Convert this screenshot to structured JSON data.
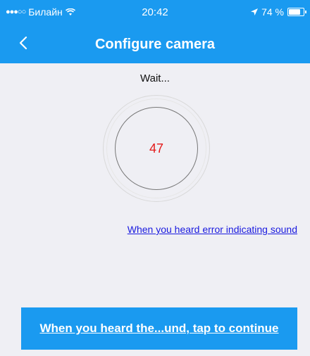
{
  "status_bar": {
    "carrier": "Билайн",
    "time": "20:42",
    "battery_percent": "74 %",
    "battery_level": 0.74,
    "icons": [
      "signal-dots-icon",
      "wifi-icon",
      "location-arrow-icon",
      "battery-icon"
    ]
  },
  "nav": {
    "title": "Configure camera",
    "back_icon": "chevron-left-icon"
  },
  "main": {
    "wait_text": "Wait...",
    "countdown": "47",
    "error_link": "When you heard error indicating sound"
  },
  "footer": {
    "continue_label": "When you heard the...und, tap to continue"
  },
  "colors": {
    "header": "#1a9af0",
    "background": "#efeff4",
    "countdown": "#e41a1a",
    "link": "#1a1adf"
  }
}
